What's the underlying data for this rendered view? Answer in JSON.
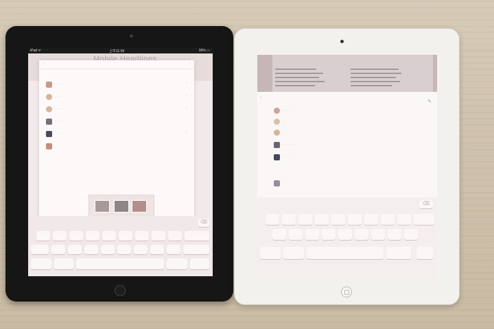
{
  "scene": {
    "left_tablet": {
      "status": {
        "left": "iPad ᯤ",
        "time": "上午11:09",
        "right": "95% ▭"
      },
      "app_title": "Mobile Headlines",
      "panel": {
        "cancel": "‹",
        "done": "›"
      },
      "contacts": [
        {
          "name": "·· ··· ··"
        },
        {
          "name": "··· ··"
        },
        {
          "name": "··· ···"
        },
        {
          "name": "···· ·· ···"
        },
        {
          "name": "·· ···"
        },
        {
          "name": ""
        }
      ]
    },
    "right_tablet": {
      "contacts": [
        {
          "name": "··· ·· ··"
        },
        {
          "name": "··"
        },
        {
          "name": "··"
        },
        {
          "name": "·· ··· ····"
        },
        {
          "name": "··· ···"
        },
        {
          "name": "··"
        }
      ]
    }
  },
  "colors": {
    "wood": "#d2c5b0",
    "black_bezel": "#161616",
    "white_bezel": "#f2f1ee",
    "screen_glow": "#f6f0f0"
  }
}
